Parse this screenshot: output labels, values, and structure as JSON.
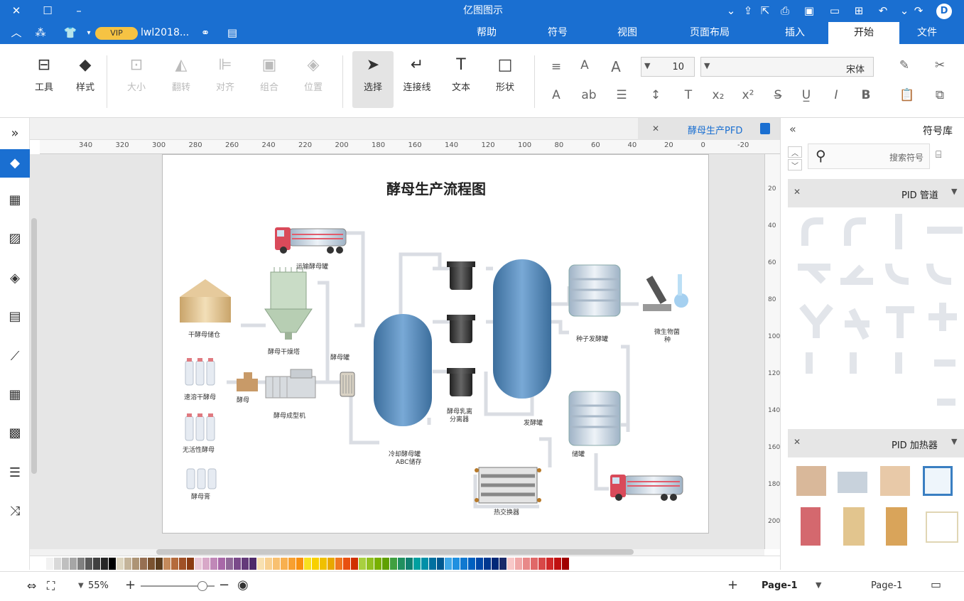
{
  "window": {
    "title": "亿图图示"
  },
  "menu": {
    "tabs": [
      "文件",
      "开始",
      "插入",
      "页面布局",
      "视图",
      "符号",
      "帮助"
    ],
    "active": "开始",
    "user": "lwl2018...",
    "vip": "VIP"
  },
  "ribbon": {
    "tools": [
      {
        "label": "工具",
        "icon": "tool-icon"
      },
      {
        "label": "样式",
        "icon": "paint-bucket-icon"
      },
      {
        "label": "大小",
        "icon": "size-icon",
        "disabled": true
      },
      {
        "label": "翻转",
        "icon": "flip-icon",
        "disabled": true
      },
      {
        "label": "对齐",
        "icon": "align-icon",
        "disabled": true
      },
      {
        "label": "组合",
        "icon": "group-icon",
        "disabled": true
      },
      {
        "label": "位置",
        "icon": "layers-icon",
        "disabled": true
      },
      {
        "label": "选择",
        "icon": "pointer-icon"
      },
      {
        "label": "连接线",
        "icon": "connector-icon"
      },
      {
        "label": "文本",
        "icon": "text-icon"
      },
      {
        "label": "形状",
        "icon": "shape-icon"
      }
    ],
    "font_size": "10",
    "font_name": "宋体"
  },
  "document": {
    "tab": "酵母生产PFD"
  },
  "ruler": {
    "labels": [
      "-20",
      "0",
      "20",
      "40",
      "60",
      "80",
      "100",
      "120",
      "140",
      "160",
      "180",
      "200",
      "220",
      "240",
      "260",
      "280",
      "300",
      "320",
      "340"
    ],
    "vlabels": [
      "20",
      "40",
      "60",
      "80",
      "100",
      "120",
      "140",
      "160",
      "180",
      "200"
    ]
  },
  "diagram": {
    "title": "酵母生产流程图",
    "labels": {
      "truck_top": "运输酵母罐",
      "dry_storage": "干酵母储仓",
      "dryer": "酵母干燥塔",
      "tank": "酵母罐",
      "dry_yeast": "干酵母储仓",
      "bottle_a": "速溶干酵母",
      "packer": "酵母",
      "forming": "酵母成型机",
      "bottle_b": "无活性酵母",
      "bottle_c": "酵母膏",
      "cooler_line1": "冷却酵母罐",
      "cooler_line2": "ABC储存",
      "separator_line1": "酵母乳离",
      "separator_line2": "分离器",
      "ferment": "发酵罐",
      "seed_tank": "种子发酵罐",
      "micro_line1": "微生物菌",
      "micro_line2": "种",
      "storage": "储罐",
      "exchanger": "热交换器"
    }
  },
  "right_panel": {
    "title": "符号库",
    "search_placeholder": "搜索符号",
    "section1": "PID 管道",
    "section2": "PID 加热器"
  },
  "status": {
    "page_tab": "Page-1",
    "page_label": "Page-1",
    "zoom": "55%"
  },
  "palette": [
    "#ffffff",
    "#f2f2f2",
    "#d9d9d9",
    "#bfbfbf",
    "#a6a6a6",
    "#808080",
    "#595959",
    "#404040",
    "#262626",
    "#000000",
    "#ddd5c0",
    "#c4b49a",
    "#ad9476",
    "#966f52",
    "#7a5230",
    "#5b3d1f",
    "#c48a5c",
    "#b56b3c",
    "#a05026",
    "#8a3a12",
    "#e8c8d8",
    "#d8a8c8",
    "#c088b8",
    "#a868a8",
    "#906898",
    "#7a4a8a",
    "#643a7a",
    "#4e2a6a",
    "#f8e0b0",
    "#f8d090",
    "#f8c070",
    "#f8b050",
    "#f8a030",
    "#f89010",
    "#f8e020",
    "#f8d000",
    "#f0c000",
    "#e8a800",
    "#f07820",
    "#e85010",
    "#d03000",
    "#a8d040",
    "#90c020",
    "#78b000",
    "#60a000",
    "#40a040",
    "#209060",
    "#108070",
    "#00a0a0",
    "#0090a8",
    "#0070a0",
    "#005890",
    "#40a8e8",
    "#2090e0",
    "#1078d0",
    "#0060c0",
    "#0048a8",
    "#003890",
    "#002878",
    "#1a2a6a",
    "#f8c8c8",
    "#f0a8a8",
    "#e88888",
    "#e06868",
    "#d84848",
    "#d02828",
    "#c01010",
    "#a00000"
  ]
}
